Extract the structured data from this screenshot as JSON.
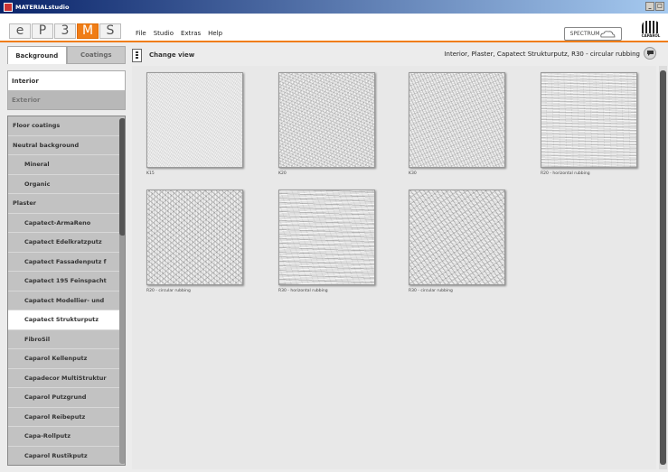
{
  "window": {
    "title": "MATERIALstudio",
    "controls": [
      "_",
      "□"
    ]
  },
  "logo": {
    "tiles": [
      "e",
      "P",
      "3",
      "M",
      "S"
    ],
    "active_index": 3,
    "accent": "#f07d16"
  },
  "menu": [
    "File",
    "Studio",
    "Extras",
    "Help"
  ],
  "brand": {
    "spectrum": "SPECTRUM",
    "caparol": "CAPAROL"
  },
  "left": {
    "tabs": [
      "Background",
      "Coatings"
    ],
    "environments": [
      "Interior",
      "Exterior"
    ],
    "categories": [
      "Floor coatings",
      "Neutral background",
      "Mineral",
      "Organic",
      "Plaster",
      "Capatect-ArmaReno",
      "Capatect Edelkratzputz",
      "Capatect Fassadenputz f",
      "Capatect 195 Feinspacht",
      "Capatect Modellier- und",
      "Capatect Strukturputz",
      "FibroSil",
      "Caparol Kellenputz",
      "Capadecor MultiStruktur",
      "Caparol Putzgrund",
      "Caparol Reibeputz",
      "Capa-Rollputz",
      "Caparol Rustikputz"
    ]
  },
  "main": {
    "change_view": "Change view",
    "breadcrumb": "Interior, Plaster, Capatect Strukturputz, R30 - circular rubbing",
    "swatches": [
      "K15",
      "K20",
      "K30",
      "R20 - horizontal rubbing",
      "R20 - circular rubbing",
      "R30 - horizontal rubbing",
      "R30 - circular rubbing"
    ]
  }
}
